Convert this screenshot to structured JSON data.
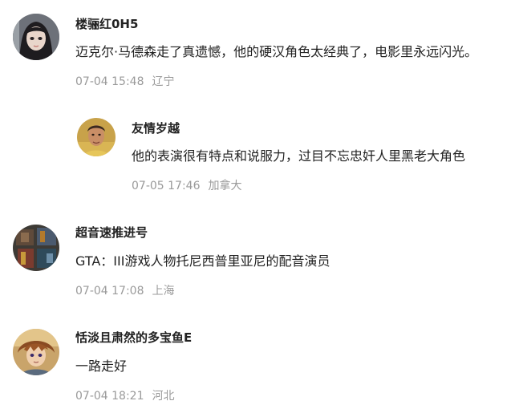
{
  "comments": [
    {
      "username": "楼骊红0H5",
      "text": "迈克尔·马德森走了真遗憾，他的硬汉角色太经典了，电影里永远闪光。",
      "time": "07-04 15:48",
      "location": "辽宁",
      "avatar": "avatar-girl-icon"
    },
    {
      "username": "友情岁越",
      "text": "他的表演很有特点和说服力，过目不忘忠奸人里黑老大角色",
      "time": "07-05 17:46",
      "location": "加拿大",
      "avatar": "avatar-man-icon",
      "reply": true
    },
    {
      "username": "超音速推进号",
      "text": "GTA：III游戏人物托尼西普里亚尼的配音演员",
      "time": "07-04 17:08",
      "location": "上海",
      "avatar": "avatar-game-icon"
    },
    {
      "username": "恬淡且肃然的多宝鱼E",
      "text": "一路走好",
      "time": "07-04 18:21",
      "location": "河北",
      "avatar": "avatar-anime-icon"
    }
  ]
}
